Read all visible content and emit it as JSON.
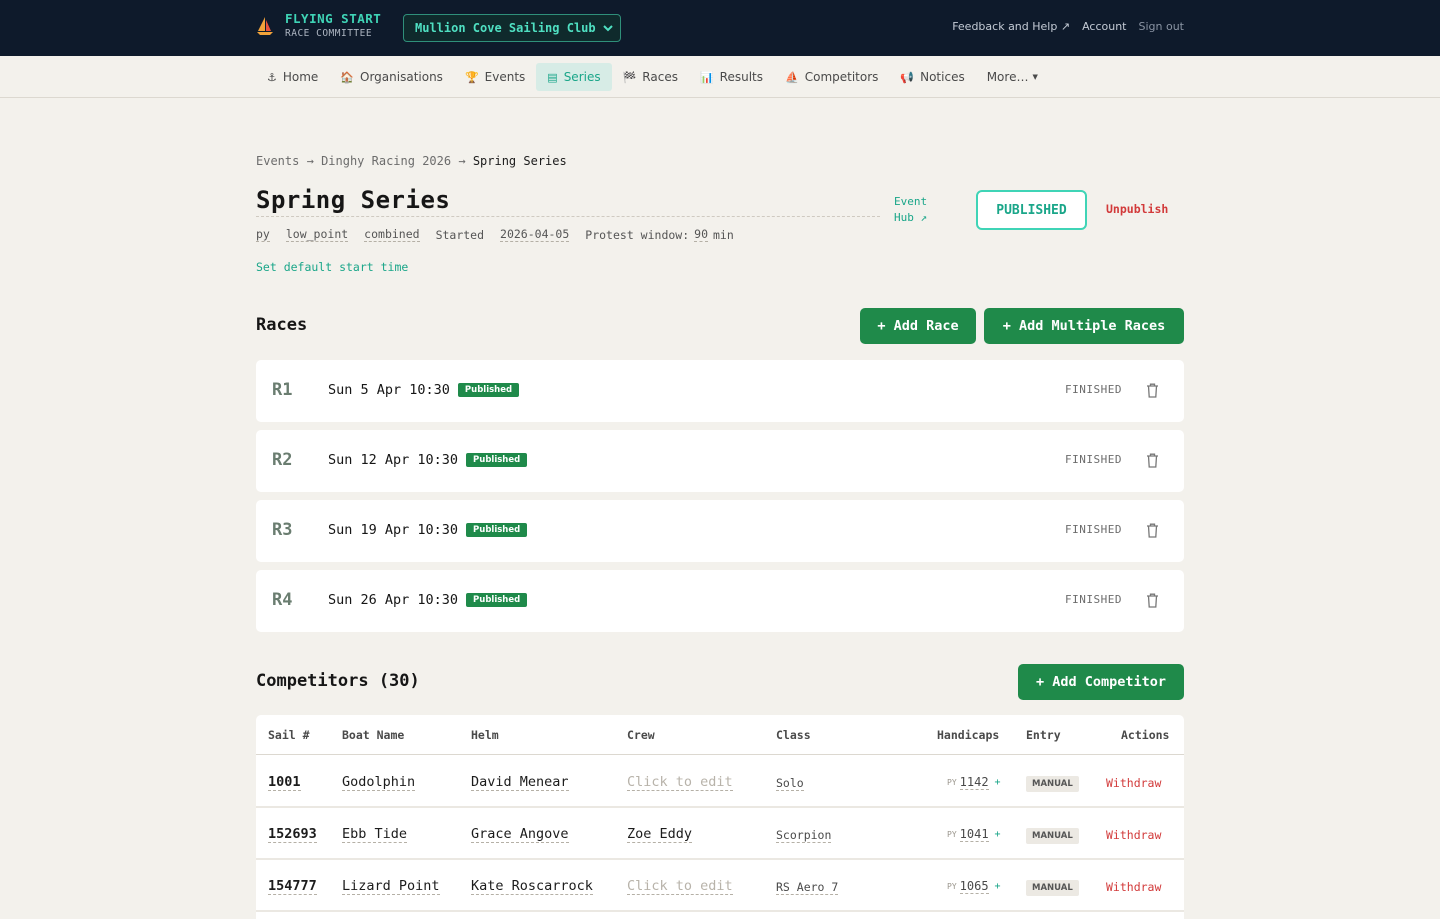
{
  "brand": {
    "title": "FLYING START",
    "subtitle": "RACE COMMITTEE"
  },
  "club_select": {
    "value": "Mullion Cove Sailing Club"
  },
  "top_links": {
    "feedback": "Feedback and Help ↗",
    "account": "Account",
    "sign_out": "Sign out"
  },
  "nav": {
    "items": [
      {
        "icon": "⚓",
        "label": "Home"
      },
      {
        "icon": "🏠",
        "label": "Organisations"
      },
      {
        "icon": "🏆",
        "label": "Events"
      },
      {
        "icon": "▤",
        "label": "Series"
      },
      {
        "icon": "🏁",
        "label": "Races"
      },
      {
        "icon": "📊",
        "label": "Results"
      },
      {
        "icon": "⛵",
        "label": "Competitors"
      },
      {
        "icon": "📢",
        "label": "Notices"
      },
      {
        "icon": "",
        "label": "More…"
      }
    ],
    "active": "Series"
  },
  "breadcrumb": {
    "events": "Events",
    "sep": "→",
    "event": "Dinghy Racing 2026",
    "current": "Spring Series"
  },
  "series": {
    "title": "Spring Series",
    "handicap": "py",
    "scoring": "low_point",
    "mode": "combined",
    "started_label": "Started",
    "start_date": "2026-04-05",
    "protest_label": "Protest window:",
    "protest_value": "90",
    "protest_unit": "min",
    "set_default_start": "Set default start time",
    "event_hub_line1": "Event",
    "event_hub_line2": "Hub ↗",
    "status": "PUBLISHED",
    "unpublish": "Unpublish"
  },
  "races_section": {
    "title": "Races",
    "add_race": "+ Add Race",
    "add_multiple": "+ Add Multiple Races",
    "races": [
      {
        "id": "R1",
        "date": "Sun 5 Apr 10:30",
        "badge": "Published",
        "status": "FINISHED"
      },
      {
        "id": "R2",
        "date": "Sun 12 Apr 10:30",
        "badge": "Published",
        "status": "FINISHED"
      },
      {
        "id": "R3",
        "date": "Sun 19 Apr 10:30",
        "badge": "Published",
        "status": "FINISHED"
      },
      {
        "id": "R4",
        "date": "Sun 26 Apr 10:30",
        "badge": "Published",
        "status": "FINISHED"
      }
    ]
  },
  "competitors_section": {
    "title": "Competitors (30)",
    "add_competitor": "+ Add Competitor",
    "columns": [
      "Sail #",
      "Boat Name",
      "Helm",
      "Crew",
      "Class",
      "Handicaps",
      "Entry",
      "Actions"
    ],
    "rows": [
      {
        "sail": "1001",
        "boat": "Godolphin",
        "helm": "David Menear",
        "crew": "Click to edit",
        "crew_empty": true,
        "class": "Solo",
        "handicap_type": "PY",
        "handicap": "1142",
        "entry": "MANUAL",
        "action": "Withdraw"
      },
      {
        "sail": "152693",
        "boat": "Ebb Tide",
        "helm": "Grace Angove",
        "crew": "Zoe Eddy",
        "crew_empty": false,
        "class": "Scorpion",
        "handicap_type": "PY",
        "handicap": "1041",
        "entry": "MANUAL",
        "action": "Withdraw"
      },
      {
        "sail": "154777",
        "boat": "Lizard Point",
        "helm": "Kate Roscarrock",
        "crew": "Click to edit",
        "crew_empty": true,
        "class": "RS Aero 7",
        "handicap_type": "PY",
        "handicap": "1065",
        "entry": "MANUAL",
        "action": "Withdraw"
      }
    ]
  },
  "colors": {
    "navy": "#0e1a2b",
    "teal": "#1aa689",
    "green": "#1f8a4a",
    "red": "#d23a3a",
    "page_bg": "#f3f1ec"
  }
}
